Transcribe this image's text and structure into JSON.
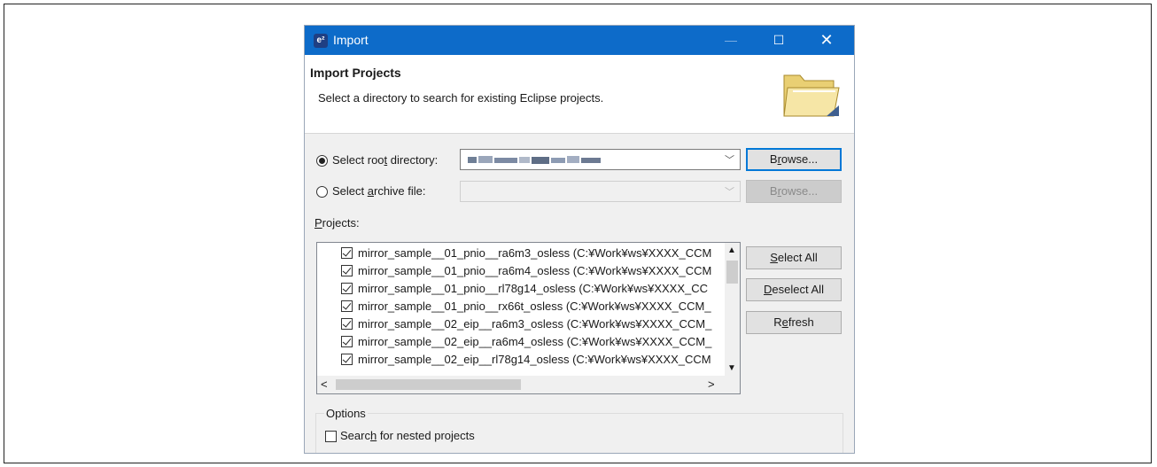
{
  "window": {
    "title": "Import",
    "app_icon_text": "e²",
    "controls": {
      "minimize": "—",
      "maximize": "☐",
      "close": "✕"
    }
  },
  "banner": {
    "heading": "Import Projects",
    "description": "Select a directory to search for existing Eclipse projects.",
    "icon": "folder-icon"
  },
  "source": {
    "root_dir_prefix": "Select roo",
    "root_dir_mnemonic": "t",
    "root_dir_suffix": " directory:",
    "root_dir_selected": true,
    "root_dir_value": "",
    "archive_prefix": "Select ",
    "archive_mnemonic": "a",
    "archive_suffix": "rchive file:",
    "archive_selected": false,
    "archive_value": "",
    "browse_label_prefix": "B",
    "browse_mnemonic": "r",
    "browse_label_suffix": "owse..."
  },
  "projects": {
    "label_mnemonic": "P",
    "label_rest": "rojects:",
    "items": [
      {
        "name": "mirror_sample__01_pnio__ra6m3_osless (C:¥Work¥ws¥XXXX_CCM",
        "checked": true
      },
      {
        "name": "mirror_sample__01_pnio__ra6m4_osless (C:¥Work¥ws¥XXXX_CCM",
        "checked": true
      },
      {
        "name": "mirror_sample__01_pnio__rl78g14_osless (C:¥Work¥ws¥XXXX_CC",
        "checked": true
      },
      {
        "name": "mirror_sample__01_pnio__rx66t_osless (C:¥Work¥ws¥XXXX_CCM_",
        "checked": true
      },
      {
        "name": "mirror_sample__02_eip__ra6m3_osless (C:¥Work¥ws¥XXXX_CCM_",
        "checked": true
      },
      {
        "name": "mirror_sample__02_eip__ra6m4_osless (C:¥Work¥ws¥XXXX_CCM_",
        "checked": true
      },
      {
        "name": "mirror_sample__02_eip__rl78g14_osless (C:¥Work¥ws¥XXXX_CCM",
        "checked": true
      }
    ]
  },
  "buttons": {
    "select_all_mnemonic": "S",
    "select_all_rest": "elect All",
    "deselect_all_mnemonic": "D",
    "deselect_all_rest": "eselect All",
    "refresh_prefix": "R",
    "refresh_mnemonic": "e",
    "refresh_rest": "fresh"
  },
  "options": {
    "group_label": "Options",
    "nested_prefix": "Searc",
    "nested_mnemonic": "h",
    "nested_rest": " for nested projects",
    "nested_checked": false
  }
}
